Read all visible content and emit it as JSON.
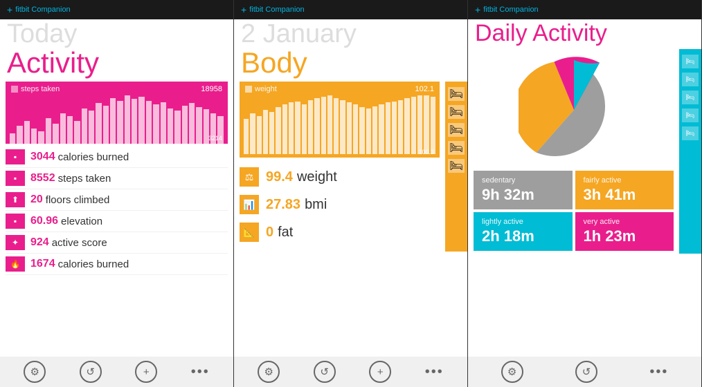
{
  "app": {
    "name": "fitbit Companion"
  },
  "panel1": {
    "header": "Today",
    "title": "Activity",
    "chart": {
      "label": "steps taken",
      "value": "18958",
      "min_value": "3214",
      "bars": [
        20,
        35,
        45,
        30,
        25,
        50,
        40,
        60,
        55,
        45,
        70,
        65,
        80,
        75,
        90,
        85,
        95,
        88,
        92,
        85,
        78,
        82,
        70,
        65,
        75,
        80,
        72,
        68,
        60,
        55
      ]
    },
    "stats": [
      {
        "icon": "🏃",
        "value": "3044",
        "label": "calories burned",
        "icon_style": "pink"
      },
      {
        "icon": "👣",
        "value": "8552",
        "label": "steps taken",
        "icon_style": "pink"
      },
      {
        "icon": "🏔",
        "value": "20",
        "label": "floors climbed",
        "icon_style": "pink"
      },
      {
        "icon": "📍",
        "value": "60.96",
        "label": "elevation",
        "icon_style": "pink"
      },
      {
        "icon": "⚙",
        "value": "924",
        "label": "active score",
        "icon_style": "pink"
      },
      {
        "icon": "🔥",
        "value": "1674",
        "label": "calories burned",
        "icon_style": "pink"
      }
    ]
  },
  "panel2": {
    "header": "2 January",
    "title": "Body",
    "chart": {
      "label": "weight",
      "value": "102.1",
      "min_value": "100.3",
      "bars": [
        60,
        70,
        65,
        75,
        72,
        80,
        85,
        88,
        90,
        85,
        92,
        95,
        98,
        100,
        95,
        92,
        88,
        85,
        80,
        78,
        82,
        85,
        88,
        90,
        92,
        95,
        98,
        100,
        100,
        98
      ]
    },
    "stats": [
      {
        "icon": "⚖",
        "value": "99.4",
        "label": "weight"
      },
      {
        "icon": "📊",
        "value": "27.83",
        "label": "bmi"
      },
      {
        "icon": "📐",
        "value": "0",
        "label": "fat"
      }
    ]
  },
  "panel3": {
    "title": "Daily Activity",
    "pie": {
      "segments": [
        {
          "label": "sedentary",
          "color": "#9e9e9e",
          "percent": 57
        },
        {
          "label": "fairly active",
          "color": "#f5a623",
          "percent": 22
        },
        {
          "label": "very active",
          "color": "#e91e8c",
          "percent": 9
        },
        {
          "label": "lightly active",
          "color": "#00bcd4",
          "percent": 12
        }
      ]
    },
    "tiles": [
      {
        "label": "sedentary",
        "value": "9h 32m",
        "style": "sedentary"
      },
      {
        "label": "fairly active",
        "value": "3h 41m",
        "style": "fairly"
      },
      {
        "label": "lightly active",
        "value": "2h 18m",
        "style": "lightly"
      },
      {
        "label": "very active",
        "value": "1h 23m",
        "style": "very"
      }
    ]
  },
  "bottom_bar": {
    "settings_label": "⚙",
    "refresh_label": "↺",
    "add_label": "+",
    "more_label": "..."
  }
}
